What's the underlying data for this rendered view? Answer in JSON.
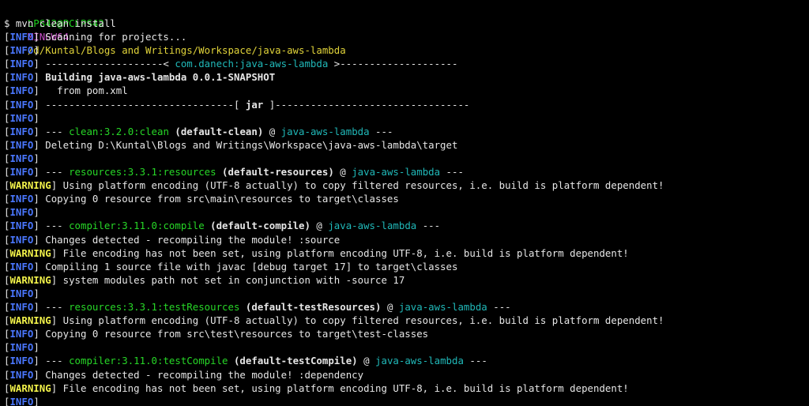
{
  "colors": {
    "background": "#000000",
    "text": "#e6e6e6",
    "prompt_user": "#1fd51f",
    "prompt_system": "#c94fc9",
    "prompt_path": "#e0d33a",
    "info_tag": "#4a77ff",
    "warning_tag": "#f2f24a",
    "plugin": "#27d727",
    "artifact": "#20b8b8"
  },
  "prompt": {
    "user": "LPS42@PCLPS42",
    "system": "MINGW64",
    "path": "/d/Kuntal/Blogs and Writings/Workspace/java-aws-lambda"
  },
  "command": "$ mvn clean install",
  "lines": [
    {
      "level": "INFO",
      "segs": [
        {
          "t": " Scanning for projects..."
        }
      ]
    },
    {
      "level": "INFO",
      "segs": []
    },
    {
      "level": "INFO",
      "segs": [
        {
          "t": " --------------------< "
        },
        {
          "t": "com.danech:java-aws-lambda",
          "c": "cyan"
        },
        {
          "t": " >--------------------"
        }
      ]
    },
    {
      "level": "INFO",
      "segs": [
        {
          "t": " Building java-aws-lambda 0.0.1-SNAPSHOT",
          "b": true
        }
      ]
    },
    {
      "level": "INFO",
      "segs": [
        {
          "t": "   from pom.xml"
        }
      ]
    },
    {
      "level": "INFO",
      "segs": [
        {
          "t": " --------------------------------[ "
        },
        {
          "t": "jar",
          "b": true
        },
        {
          "t": " ]---------------------------------"
        }
      ]
    },
    {
      "level": "INFO",
      "segs": []
    },
    {
      "level": "INFO",
      "segs": [
        {
          "t": " --- "
        },
        {
          "t": "clean:3.2.0:clean",
          "c": "lime"
        },
        {
          "t": " (default-clean)",
          "b": true
        },
        {
          "t": " @ "
        },
        {
          "t": "java-aws-lambda",
          "c": "cyan"
        },
        {
          "t": " ---"
        }
      ]
    },
    {
      "level": "INFO",
      "segs": [
        {
          "t": " Deleting D:\\Kuntal\\Blogs and Writings\\Workspace\\java-aws-lambda\\target"
        }
      ]
    },
    {
      "level": "INFO",
      "segs": []
    },
    {
      "level": "INFO",
      "segs": [
        {
          "t": " --- "
        },
        {
          "t": "resources:3.3.1:resources",
          "c": "lime"
        },
        {
          "t": " (default-resources)",
          "b": true
        },
        {
          "t": " @ "
        },
        {
          "t": "java-aws-lambda",
          "c": "cyan"
        },
        {
          "t": " ---"
        }
      ]
    },
    {
      "level": "WARNING",
      "segs": [
        {
          "t": " Using platform encoding (UTF-8 actually) to copy filtered resources, i.e. build is platform dependent!"
        }
      ]
    },
    {
      "level": "INFO",
      "segs": [
        {
          "t": " Copying 0 resource from src\\main\\resources to target\\classes"
        }
      ]
    },
    {
      "level": "INFO",
      "segs": []
    },
    {
      "level": "INFO",
      "segs": [
        {
          "t": " --- "
        },
        {
          "t": "compiler:3.11.0:compile",
          "c": "lime"
        },
        {
          "t": " (default-compile)",
          "b": true
        },
        {
          "t": " @ "
        },
        {
          "t": "java-aws-lambda",
          "c": "cyan"
        },
        {
          "t": " ---"
        }
      ]
    },
    {
      "level": "INFO",
      "segs": [
        {
          "t": " Changes detected - recompiling the module! :source"
        }
      ]
    },
    {
      "level": "WARNING",
      "segs": [
        {
          "t": " File encoding has not been set, using platform encoding UTF-8, i.e. build is platform dependent!"
        }
      ]
    },
    {
      "level": "INFO",
      "segs": [
        {
          "t": " Compiling 1 source file with javac [debug target 17] to target\\classes"
        }
      ]
    },
    {
      "level": "WARNING",
      "segs": [
        {
          "t": " system modules path not set in conjunction with -source 17"
        }
      ]
    },
    {
      "level": "INFO",
      "segs": []
    },
    {
      "level": "INFO",
      "segs": [
        {
          "t": " --- "
        },
        {
          "t": "resources:3.3.1:testResources",
          "c": "lime"
        },
        {
          "t": " (default-testResources)",
          "b": true
        },
        {
          "t": " @ "
        },
        {
          "t": "java-aws-lambda",
          "c": "cyan"
        },
        {
          "t": " ---"
        }
      ]
    },
    {
      "level": "WARNING",
      "segs": [
        {
          "t": " Using platform encoding (UTF-8 actually) to copy filtered resources, i.e. build is platform dependent!"
        }
      ]
    },
    {
      "level": "INFO",
      "segs": [
        {
          "t": " Copying 0 resource from src\\test\\resources to target\\test-classes"
        }
      ]
    },
    {
      "level": "INFO",
      "segs": []
    },
    {
      "level": "INFO",
      "segs": [
        {
          "t": " --- "
        },
        {
          "t": "compiler:3.11.0:testCompile",
          "c": "lime"
        },
        {
          "t": " (default-testCompile)",
          "b": true
        },
        {
          "t": " @ "
        },
        {
          "t": "java-aws-lambda",
          "c": "cyan"
        },
        {
          "t": " ---"
        }
      ]
    },
    {
      "level": "INFO",
      "segs": [
        {
          "t": " Changes detected - recompiling the module! :dependency"
        }
      ]
    },
    {
      "level": "WARNING",
      "segs": [
        {
          "t": " File encoding has not been set, using platform encoding UTF-8, i.e. build is platform dependent!"
        }
      ]
    },
    {
      "level": "INFO",
      "segs": []
    }
  ]
}
